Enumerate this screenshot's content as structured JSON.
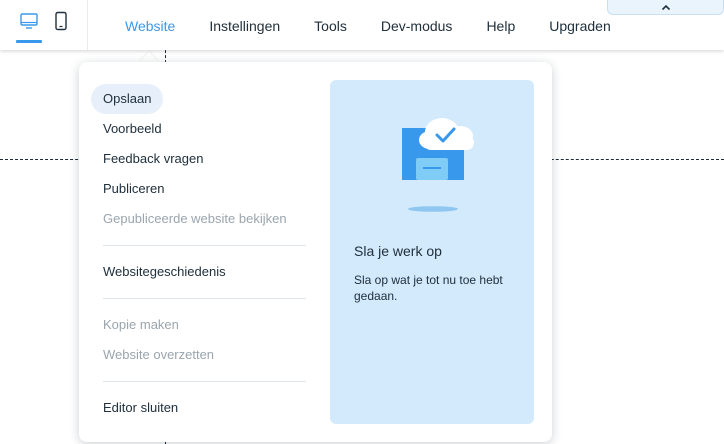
{
  "topbar": {
    "devices": [
      {
        "name": "desktop-icon",
        "active": true
      },
      {
        "name": "mobile-icon",
        "active": false
      }
    ],
    "menu": [
      {
        "label": "Website",
        "active": true
      },
      {
        "label": "Instellingen",
        "active": false
      },
      {
        "label": "Tools",
        "active": false
      },
      {
        "label": "Dev-modus",
        "active": false
      },
      {
        "label": "Help",
        "active": false
      },
      {
        "label": "Upgraden",
        "active": false
      }
    ],
    "collapse_icon": "chevron-up-icon"
  },
  "dropdown": {
    "items": [
      {
        "label": "Opslaan",
        "state": "selected"
      },
      {
        "label": "Voorbeeld",
        "state": "normal"
      },
      {
        "label": "Feedback vragen",
        "state": "normal"
      },
      {
        "label": "Publiceren",
        "state": "normal"
      },
      {
        "label": "Gepubliceerde website bekijken",
        "state": "disabled"
      },
      {
        "label": "Websitegeschiedenis",
        "state": "normal"
      },
      {
        "label": "Kopie maken",
        "state": "disabled"
      },
      {
        "label": "Website overzetten",
        "state": "disabled"
      },
      {
        "label": "Editor sluiten",
        "state": "normal"
      }
    ],
    "preview": {
      "icon": "save-cloud-icon",
      "title": "Sla je werk op",
      "description": "Sla op wat je tot nu toe hebt gedaan."
    }
  },
  "colors": {
    "accent": "#3899ec",
    "text": "#20303c",
    "disabled_text": "#9aa5ae",
    "preview_bg": "#d3eafd",
    "selected_bg": "#e7f0fa"
  }
}
